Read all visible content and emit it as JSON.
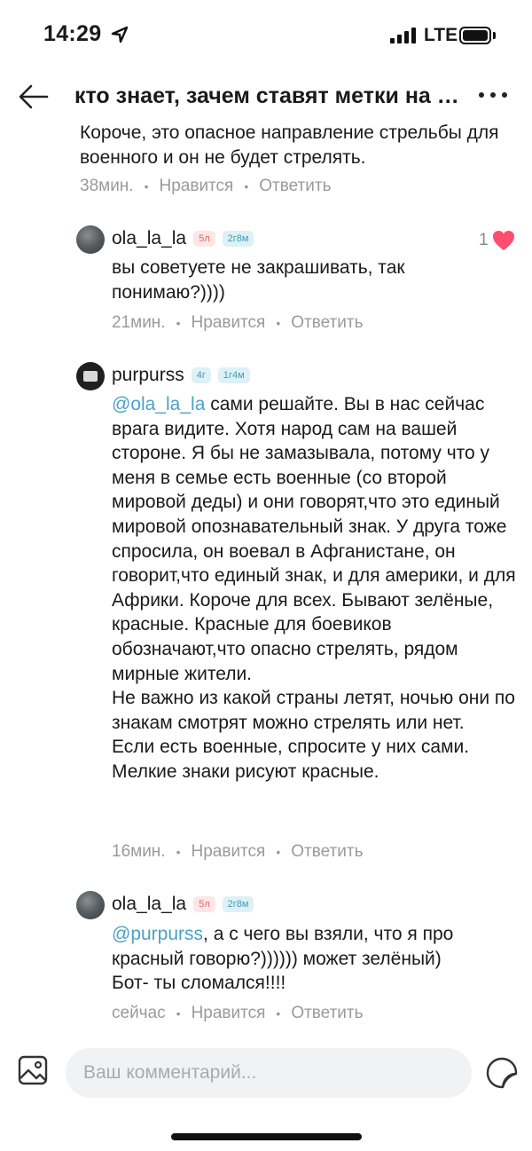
{
  "status_bar": {
    "time": "14:29",
    "network": "LTE"
  },
  "nav": {
    "title": "кто знает, зачем ставят метки на крышах?"
  },
  "comments": [
    {
      "body": "Короче, это опасное направление стрельбы для военного и он не будет стрелять.",
      "time": "38мин.",
      "like_label": "Нравится",
      "reply_label": "Ответить"
    },
    {
      "username": "ola_la_la",
      "badge_1": "5л",
      "badge_2": "2г8м",
      "body": "вы советуете не закрашивать, так понимаю?))))",
      "time": "21мин.",
      "like_label": "Нравится",
      "reply_label": "Ответить",
      "likes": "1"
    },
    {
      "username": "purpurss",
      "badge_1": "4г",
      "badge_2": "1г4м",
      "mention": "@ola_la_la",
      "body": " сами решайте. Вы в нас сейчас врага видите. Хотя народ сам на вашей стороне. Я бы не замазывала, потому что у меня в семье есть военные (со второй мировой деды) и они говорят,что это единый мировой опознавательный знак. У друга тоже спросила, он воевал в Афганистане, он говорит,что единый знак, и для америки, и для Африки. Короче для всех. Бывают зелёные, красные. Красные для боевиков обозначают,что опасно стрелять, рядом мирные жители.",
      "body_2": "Не важно из какой страны летят, ночью они по знакам смотрят можно стрелять или нет.",
      "body_3": "Если есть военные, спросите у них сами. Мелкие знаки рисуют красные.",
      "time": "16мин.",
      "like_label": "Нравится",
      "reply_label": "Ответить"
    },
    {
      "username": "ola_la_la",
      "badge_1": "5л",
      "badge_2": "2г8м",
      "mention": "@purpurss",
      "body": ", а с чего вы взяли, что я про красный говорю?)))))) может зелёный)",
      "body_2": "Бот- ты сломался!!!!",
      "time": "сейчас",
      "like_label": "Нравится",
      "reply_label": "Ответить"
    }
  ],
  "composer": {
    "placeholder": "Ваш комментарий..."
  },
  "colors": {
    "accent": "#4aa1c7",
    "heart": "#ff4d6d",
    "muted": "#9a9a9a"
  },
  "icons": [
    "back-arrow-icon",
    "more-icon",
    "heart-icon",
    "image-icon",
    "sticker-icon",
    "location-arrow-icon"
  ]
}
